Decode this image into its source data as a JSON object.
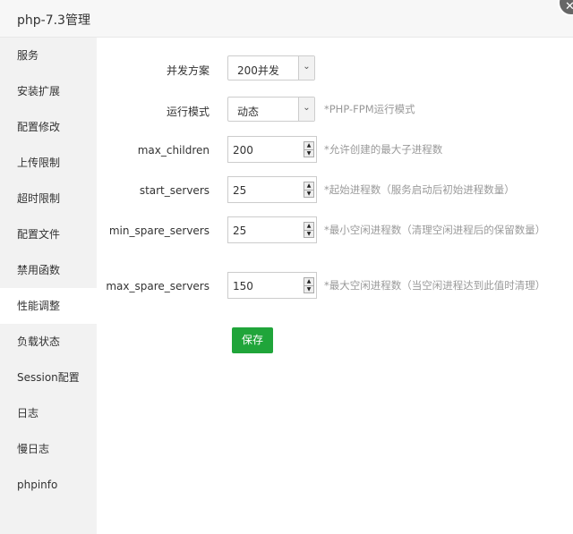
{
  "window": {
    "title": "php-7.3管理",
    "close_glyph": "✕"
  },
  "sidebar": {
    "items": [
      {
        "label": "服务"
      },
      {
        "label": "安装扩展"
      },
      {
        "label": "配置修改"
      },
      {
        "label": "上传限制"
      },
      {
        "label": "超时限制"
      },
      {
        "label": "配置文件"
      },
      {
        "label": "禁用函数"
      },
      {
        "label": "性能调整",
        "active": true
      },
      {
        "label": "负载状态"
      },
      {
        "label": "Session配置"
      },
      {
        "label": "日志"
      },
      {
        "label": "慢日志"
      },
      {
        "label": "phpinfo"
      }
    ]
  },
  "form": {
    "concurrency": {
      "label": "并发方案",
      "value": "200并发"
    },
    "run_mode": {
      "label": "运行模式",
      "value": "动态",
      "hint": "*PHP-FPM运行模式"
    },
    "max_children": {
      "label": "max_children",
      "value": "200",
      "hint": "*允许创建的最大子进程数"
    },
    "start_servers": {
      "label": "start_servers",
      "value": "25",
      "hint": "*起始进程数（服务启动后初始进程数量）"
    },
    "min_spare_servers": {
      "label": "min_spare_servers",
      "value": "25",
      "hint": "*最小空闲进程数（清理空闲进程后的保留数量）"
    },
    "max_spare_servers": {
      "label": "max_spare_servers",
      "value": "150",
      "hint": "*最大空闲进程数（当空闲进程达到此值时清理）"
    },
    "save_label": "保存"
  },
  "colors": {
    "accent": "#20a53a",
    "sidebar_bg": "#f2f2f2",
    "hint": "#999999"
  }
}
